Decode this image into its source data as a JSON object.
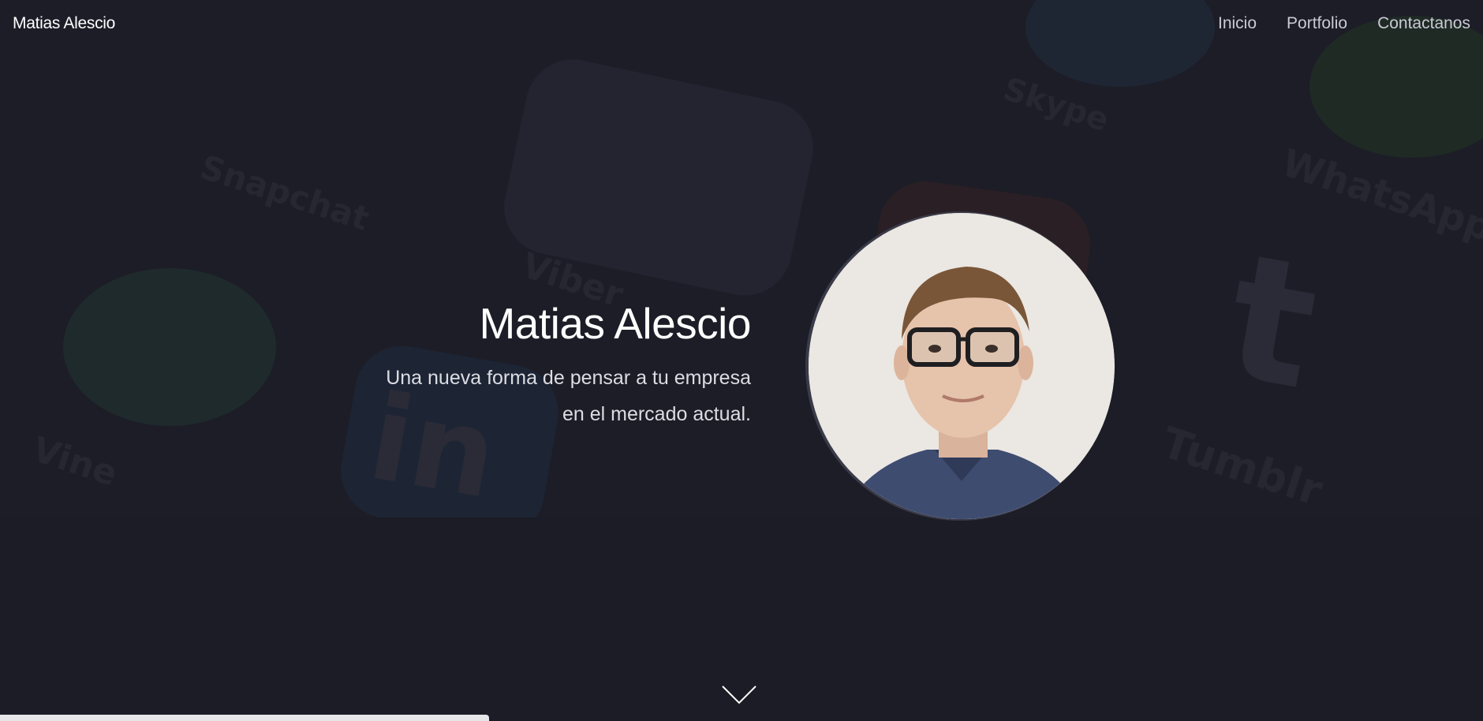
{
  "navbar": {
    "brand": "Matias Alescio",
    "links": [
      "Inicio",
      "Portfolio",
      "Contactanos"
    ]
  },
  "hero": {
    "title": "Matias Alescio",
    "subtitle_line1": "Una nueva forma de pensar a tu empresa",
    "subtitle_line2": "en el mercado actual."
  },
  "background_labels": [
    "Vine",
    "Tumblr",
    "WhatsApp",
    "Viber",
    "Skype",
    "Snapchat",
    "in",
    "t"
  ],
  "colors": {
    "background": "#1a1b24",
    "text": "#ffffff",
    "nav_text": "#c9cad3",
    "avatar_ring": "#3a3b49"
  },
  "icons": [
    "chevron-down-icon"
  ],
  "scroll_progress": 0.33
}
